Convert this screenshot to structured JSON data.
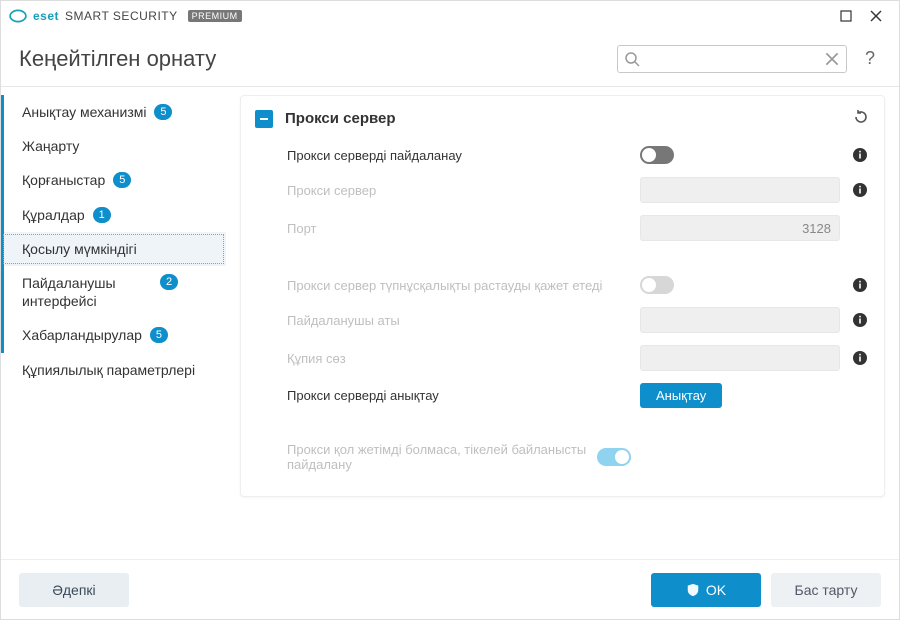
{
  "brand": {
    "name": "SMART SECURITY",
    "edition": "PREMIUM",
    "eset": "eset"
  },
  "page_title": "Кеңейтілген орнату",
  "search": {
    "placeholder": ""
  },
  "sidebar": {
    "items": [
      {
        "label": "Анықтау механизмі",
        "badge": "5"
      },
      {
        "label": "Жаңарту",
        "badge": ""
      },
      {
        "label": "Қорғаныстар",
        "badge": "5"
      },
      {
        "label": "Құралдар",
        "badge": "1"
      },
      {
        "label": "Қосылу мүмкіндігі",
        "badge": ""
      },
      {
        "label": "Пайдаланушы интерфейсі",
        "badge": "2"
      },
      {
        "label": "Хабарландырулар",
        "badge": "5"
      },
      {
        "label": "Құпиялылық параметрлері",
        "badge": ""
      }
    ]
  },
  "panel": {
    "title": "Прокси сервер",
    "rows": {
      "use_proxy": {
        "label": "Прокси серверді пайдаланау"
      },
      "proxy_server": {
        "label": "Прокси сервер",
        "value": ""
      },
      "port": {
        "label": "Порт",
        "value": "3128"
      },
      "auth_required": {
        "label": "Прокси сервер түпнұсқалықты растауды қажет етеді"
      },
      "username": {
        "label": "Пайдаланушы аты",
        "value": ""
      },
      "password": {
        "label": "Құпия сөз",
        "value": ""
      },
      "detect": {
        "label": "Прокси серверді анықтау",
        "button": "Анықтау"
      },
      "fallback_direct": {
        "label": "Прокси қол жетімді болмаса, тікелей байланысты пайдалану"
      }
    }
  },
  "footer": {
    "default": "Әдепкі",
    "ok": "OK",
    "cancel": "Бас тарту"
  }
}
